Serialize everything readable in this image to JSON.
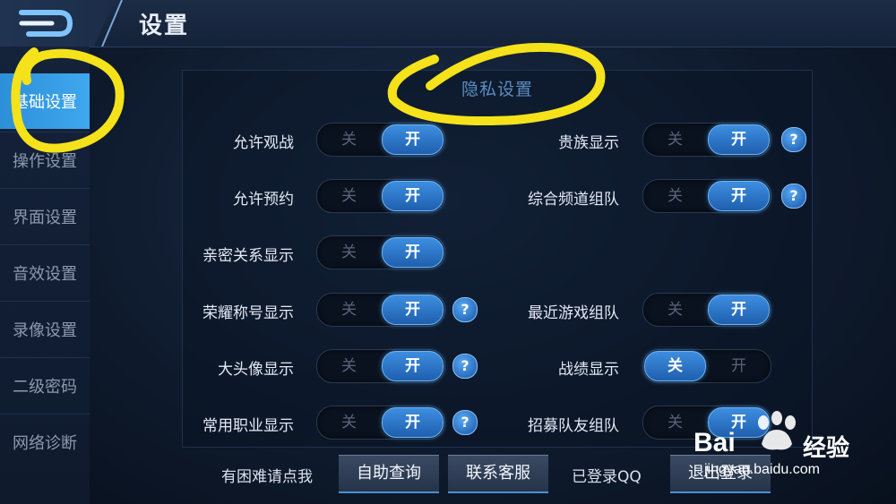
{
  "header": {
    "title": "设置"
  },
  "sidebar": {
    "items": [
      {
        "label": "基础设置",
        "active": true
      },
      {
        "label": "操作设置"
      },
      {
        "label": "界面设置"
      },
      {
        "label": "音效设置"
      },
      {
        "label": "录像设置"
      },
      {
        "label": "二级密码"
      },
      {
        "label": "网络诊断"
      }
    ]
  },
  "panel": {
    "title": "隐私设置",
    "off_label": "关",
    "on_label": "开",
    "help_label": "?",
    "left_rows": [
      {
        "label": "允许观战",
        "state": "on",
        "help": false
      },
      {
        "label": "允许预约",
        "state": "on",
        "help": false
      },
      {
        "label": "亲密关系显示",
        "state": "on",
        "help": false
      },
      {
        "label": "荣耀称号显示",
        "state": "on",
        "help": true
      },
      {
        "label": "大头像显示",
        "state": "on",
        "help": true
      },
      {
        "label": "常用职业显示",
        "state": "on",
        "help": true
      }
    ],
    "right_rows": [
      {
        "label": "贵族显示",
        "state": "on",
        "help": true
      },
      {
        "label": "综合频道组队",
        "state": "on",
        "help": true
      },
      {
        "label": "最近游戏组队",
        "state": "on",
        "help": false
      },
      {
        "label": "战绩显示",
        "state": "off",
        "help": false
      },
      {
        "label": "招募队友组队",
        "state": "on",
        "help": false
      }
    ]
  },
  "bottom": {
    "help_prompt": "有困难请点我",
    "self_help_button": "自助查询",
    "contact_button": "联系客服",
    "login_status": "已登录QQ",
    "logout_button": "退出登录"
  },
  "watermark": {
    "brand": "Bai",
    "brand_suffix": "经验",
    "url": "jingyan.baidu.com"
  },
  "colors": {
    "accent": "#3fa8ee",
    "annotation": "#f5e21a"
  }
}
